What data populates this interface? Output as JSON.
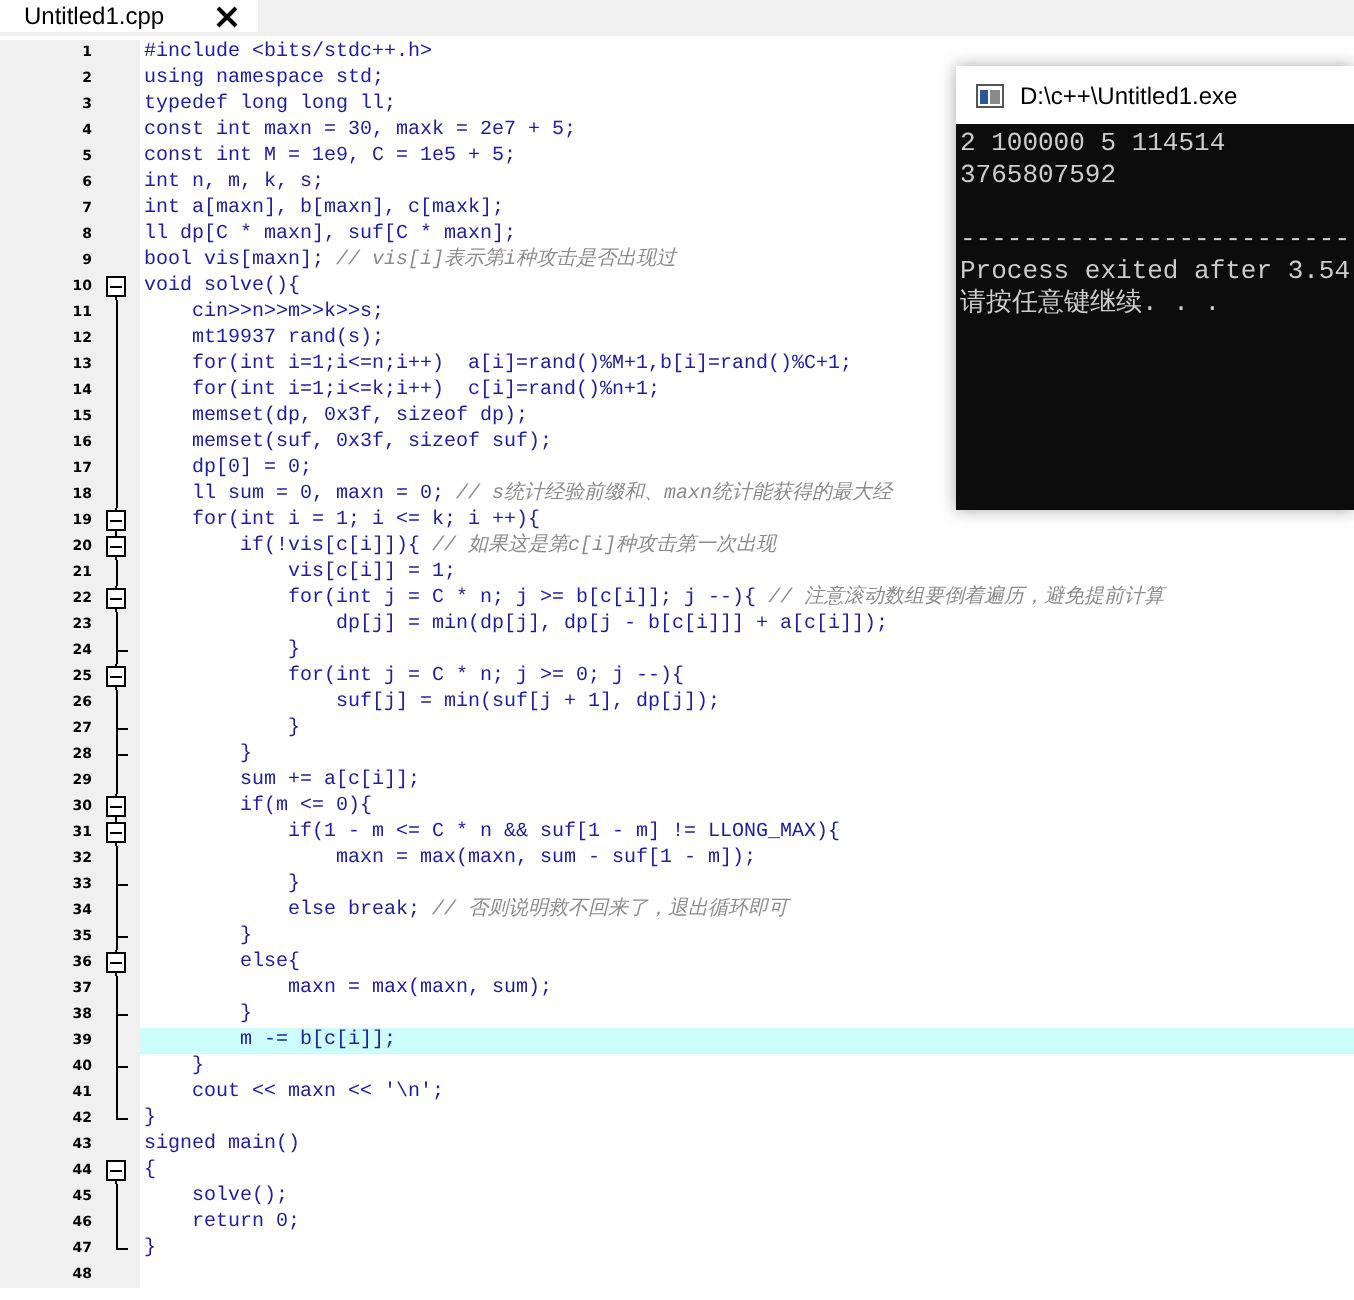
{
  "tab": {
    "title": "Untitled1.cpp"
  },
  "editor": {
    "lines": [
      {
        "number": "1",
        "code": "#include <bits/stdc++.h>"
      },
      {
        "number": "2",
        "code": "using namespace std;"
      },
      {
        "number": "3",
        "code": "typedef long long ll;"
      },
      {
        "number": "4",
        "code": "const int maxn = 30, maxk = 2e7 + 5;"
      },
      {
        "number": "5",
        "code": "const int M = 1e9, C = 1e5 + 5;"
      },
      {
        "number": "6",
        "code": "int n, m, k, s;"
      },
      {
        "number": "7",
        "code": "int a[maxn], b[maxn], c[maxk];"
      },
      {
        "number": "8",
        "code": "ll dp[C * maxn], suf[C * maxn];"
      },
      {
        "number": "9",
        "code": "bool vis[maxn]; ",
        "comment": "// vis[i]表示第i种攻击是否出现过"
      },
      {
        "number": "10",
        "code": "void solve(){",
        "kind": "open"
      },
      {
        "number": "11",
        "code": "    cin>>n>>m>>k>>s;",
        "kind": "mid"
      },
      {
        "number": "12",
        "code": "    mt19937 rand(s);",
        "kind": "mid"
      },
      {
        "number": "13",
        "code": "    for(int i=1;i<=n;i++)  a[i]=rand()%M+1,b[i]=rand()%C+1;",
        "kind": "mid"
      },
      {
        "number": "14",
        "code": "    for(int i=1;i<=k;i++)  c[i]=rand()%n+1;",
        "kind": "mid"
      },
      {
        "number": "15",
        "code": "    memset(dp, 0x3f, sizeof dp);",
        "kind": "mid"
      },
      {
        "number": "16",
        "code": "    memset(suf, 0x3f, sizeof suf);",
        "kind": "mid"
      },
      {
        "number": "17",
        "code": "    dp[0] = 0;",
        "kind": "mid"
      },
      {
        "number": "18",
        "code": "    ll sum = 0, maxn = 0; ",
        "comment": "// s统计经验前缀和、maxn统计能获得的最大经",
        "kind": "mid"
      },
      {
        "number": "19",
        "code": "    for(int i = 1; i <= k; i ++){",
        "kind": "start"
      },
      {
        "number": "20",
        "code": "        if(!vis[c[i]]){ ",
        "comment": "// 如果这是第c[i]种攻击第一次出现",
        "kind": "start"
      },
      {
        "number": "21",
        "code": "            vis[c[i]] = 1;",
        "kind": "mid"
      },
      {
        "number": "22",
        "code": "            for(int j = C * n; j >= b[c[i]]; j --){ ",
        "comment": "// 注意滚动数组要倒着遍历，避免提前计算",
        "kind": "start"
      },
      {
        "number": "23",
        "code": "                dp[j] = min(dp[j], dp[j - b[c[i]]] + a[c[i]]);",
        "kind": "mid"
      },
      {
        "number": "24",
        "code": "            }",
        "kind": "end"
      },
      {
        "number": "25",
        "code": "            for(int j = C * n; j >= 0; j --){",
        "kind": "start"
      },
      {
        "number": "26",
        "code": "                suf[j] = min(suf[j + 1], dp[j]);",
        "kind": "mid"
      },
      {
        "number": "27",
        "code": "            }",
        "kind": "end"
      },
      {
        "number": "28",
        "code": "        }",
        "kind": "end"
      },
      {
        "number": "29",
        "code": "        sum += a[c[i]];",
        "kind": "mid"
      },
      {
        "number": "30",
        "code": "        if(m <= 0){",
        "kind": "start"
      },
      {
        "number": "31",
        "code": "            if(1 - m <= C * n && suf[1 - m] != LLONG_MAX){",
        "kind": "start"
      },
      {
        "number": "32",
        "code": "                maxn = max(maxn, sum - suf[1 - m]);",
        "kind": "mid"
      },
      {
        "number": "33",
        "code": "            }",
        "kind": "end"
      },
      {
        "number": "34",
        "code": "            else break; ",
        "comment": "// 否则说明救不回来了，退出循环即可",
        "kind": "mid"
      },
      {
        "number": "35",
        "code": "        }",
        "kind": "end"
      },
      {
        "number": "36",
        "code": "        else{",
        "kind": "start"
      },
      {
        "number": "37",
        "code": "            maxn = max(maxn, sum);",
        "kind": "mid"
      },
      {
        "number": "38",
        "code": "        }",
        "kind": "end"
      },
      {
        "number": "39",
        "code": "        m -= b[c[i]];",
        "kind": "mid",
        "highlighted": true
      },
      {
        "number": "40",
        "code": "    }",
        "kind": "end"
      },
      {
        "number": "41",
        "code": "    cout << maxn << '\\n';",
        "kind": "mid"
      },
      {
        "number": "42",
        "code": "}",
        "kind": "close"
      },
      {
        "number": "43",
        "code": "signed main()"
      },
      {
        "number": "44",
        "code": "{",
        "kind": "open"
      },
      {
        "number": "45",
        "code": "    solve();",
        "kind": "mid"
      },
      {
        "number": "46",
        "code": "    return 0;",
        "kind": "mid"
      },
      {
        "number": "47",
        "code": "}",
        "kind": "close"
      },
      {
        "number": "48"
      }
    ]
  },
  "console": {
    "title": "D:\\c++\\Untitled1.exe",
    "lines": [
      {
        "text": "2 100000 5 114514"
      },
      {
        "text": "3765807592"
      },
      {
        "text": "-------------------------",
        "blank_before": true
      },
      {
        "text": "Process exited after 3.54"
      },
      {
        "text": "请按任意键继续. . ."
      }
    ]
  }
}
